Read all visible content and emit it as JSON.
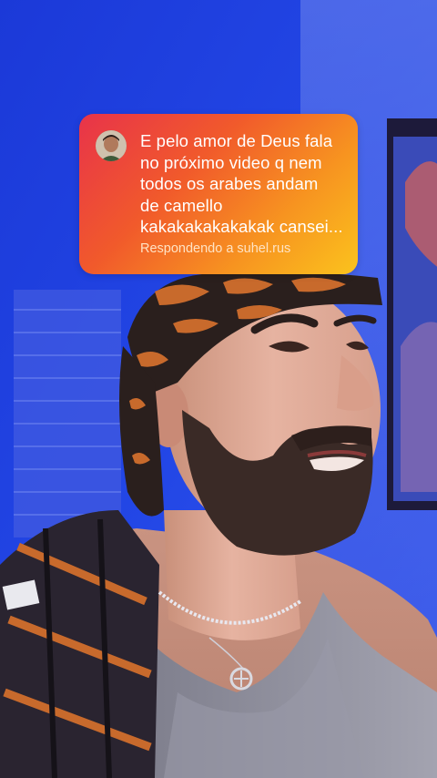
{
  "reply_card": {
    "comment_lines": [
      "E pelo amor de Deus fala",
      "no próximo video q nem",
      "todos os arabes andam",
      "de camello",
      "kakakakakakakak cansei..."
    ],
    "replying_to": "Respondendo a suhel.rus"
  },
  "colors": {
    "background": "#1f3fe0",
    "card_gradient_start": "#e8334a",
    "card_gradient_end": "#fbc31d"
  },
  "icons": {
    "avatar": "commenter-avatar"
  }
}
